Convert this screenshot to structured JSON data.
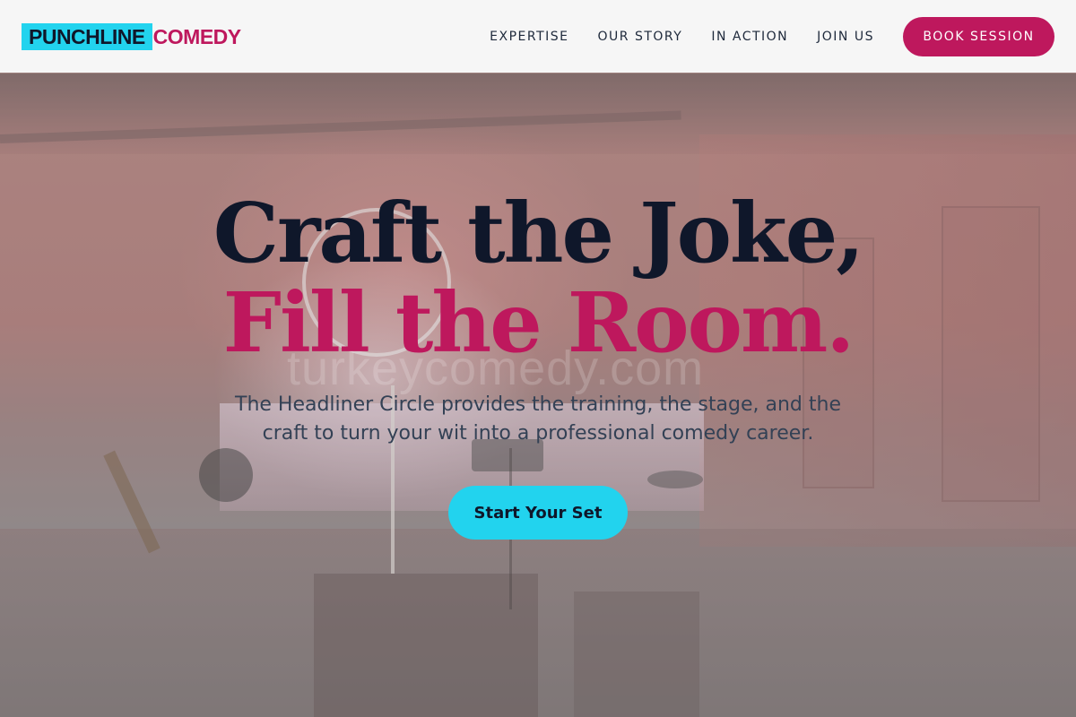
{
  "brand": {
    "logo_part1": "PUNCHLINE",
    "logo_part2": "COMEDY",
    "primary_color": "#be185d",
    "accent_color": "#22d3ee"
  },
  "nav": {
    "links": [
      "EXPERTISE",
      "OUR STORY",
      "IN ACTION",
      "JOIN US"
    ],
    "cta_label": "BOOK SESSION"
  },
  "hero": {
    "headline_line1": "Craft the Joke,",
    "headline_line2": "Fill the Room.",
    "subtitle": "The Headliner Circle provides the training, the stage, and the craft to turn your wit into a professional comedy career.",
    "cta_label": "Start Your Set",
    "watermark": "turkeycomedy.com"
  }
}
